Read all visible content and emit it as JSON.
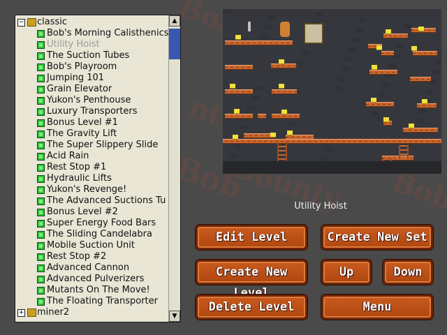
{
  "tree": {
    "root_sets": [
      {
        "label": "classic",
        "expanded": true
      },
      {
        "label": "miner2",
        "expanded": false
      }
    ],
    "levels": [
      "Bob's Morning Calisthenics!",
      "Utility Hoist",
      "The Suction Tubes",
      "Bob's Playroom",
      "Jumping 101",
      "Grain Elevator",
      "Yukon's Penthouse",
      "Luxury Transporters",
      "Bonus Level #1",
      "The Gravity Lift",
      "The Super Slippery Slide",
      "Acid Rain",
      "Rest Stop #1",
      "Hydraulic Lifts",
      "Yukon's Revenge!",
      "The Advanced Suctions Tu",
      "Bonus Level #2",
      "Super Energy Food Bars",
      "The Sliding Candelabra",
      "Mobile Suction Unit",
      "Rest Stop #2",
      "Advanced Cannon",
      "Advanced Pulverizers",
      "Mutants On The Move!",
      "The Floating Transporter"
    ],
    "selected_level": "Utility Hoist"
  },
  "preview": {
    "level_name": "Utility Hoist"
  },
  "buttons": {
    "edit_level": "Edit Level",
    "create_new_set": "Create New Set",
    "create_new_level": "Create New Level",
    "up": "Up",
    "down": "Down",
    "delete_level": "Delete Level",
    "menu": "Menu"
  },
  "colors": {
    "button_orange": "#c85a1e",
    "background": "#4a4a4a",
    "tree_background": "#e9e6d6",
    "scroll_thumb": "#3a57b0"
  }
}
